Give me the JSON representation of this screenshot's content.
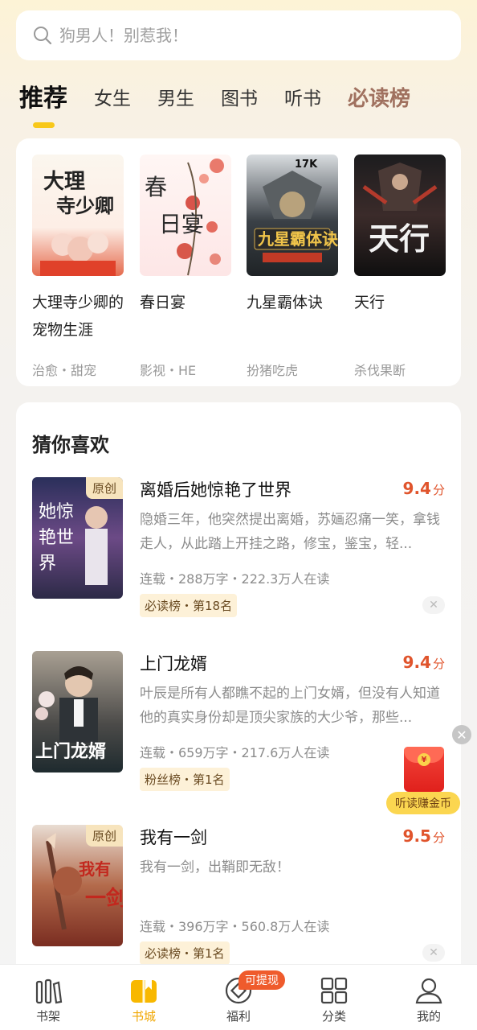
{
  "search": {
    "placeholder": "狗男人！别惹我！"
  },
  "tabs": [
    "推荐",
    "女生",
    "男生",
    "图书",
    "听书",
    "必读榜"
  ],
  "featured": [
    {
      "title": "大理寺少卿的宠物生涯",
      "tags": "治愈・甜宠",
      "cover_text": "大理寺少卿"
    },
    {
      "title": "春日宴",
      "tags": "影视・HE",
      "cover_text": "春日宴"
    },
    {
      "title": "九星霸体诀",
      "tags": "扮猪吃虎",
      "cover_text": "九星霸体诀",
      "cover_logo": "17K"
    },
    {
      "title": "天行",
      "tags": "杀伐果断",
      "cover_text": "天行"
    }
  ],
  "guess": {
    "title": "猜你喜欢",
    "items": [
      {
        "name": "离婚后她惊艳了世界",
        "score": "9.4",
        "score_unit": "分",
        "badge": "原创",
        "desc": "隐婚三年，他突然提出离婚，苏婳忍痛一笑，拿钱走人，从此踏上开挂之路，修宝，鉴宝，轻...",
        "meta": "连载・288万字・222.3万人在读",
        "rank": "必读榜・第18名",
        "cover_text": "她惊艳世界"
      },
      {
        "name": "上门龙婿",
        "score": "9.4",
        "score_unit": "分",
        "badge": "",
        "desc": "叶辰是所有人都瞧不起的上门女婿，但没有人知道他的真实身份却是顶尖家族的大少爷，那些...",
        "meta": "连载・659万字・217.6万人在读",
        "rank": "粉丝榜・第1名",
        "cover_text": "上门龙婿"
      },
      {
        "name": "我有一剑",
        "score": "9.5",
        "score_unit": "分",
        "badge": "原创",
        "desc": "我有一剑，出鞘即无敌！",
        "meta": "连载・396万字・560.8万人在读",
        "rank": "必读榜・第1名",
        "cover_text": "我有一剑"
      }
    ]
  },
  "floating": {
    "label": "听读赚金币"
  },
  "nav": {
    "items": [
      "书架",
      "书城",
      "福利",
      "分类",
      "我的"
    ],
    "withdraw_badge": "可提现"
  },
  "colors": {
    "accent": "#f8c81a",
    "score": "#e0542c",
    "nav_active": "#f0a600"
  }
}
